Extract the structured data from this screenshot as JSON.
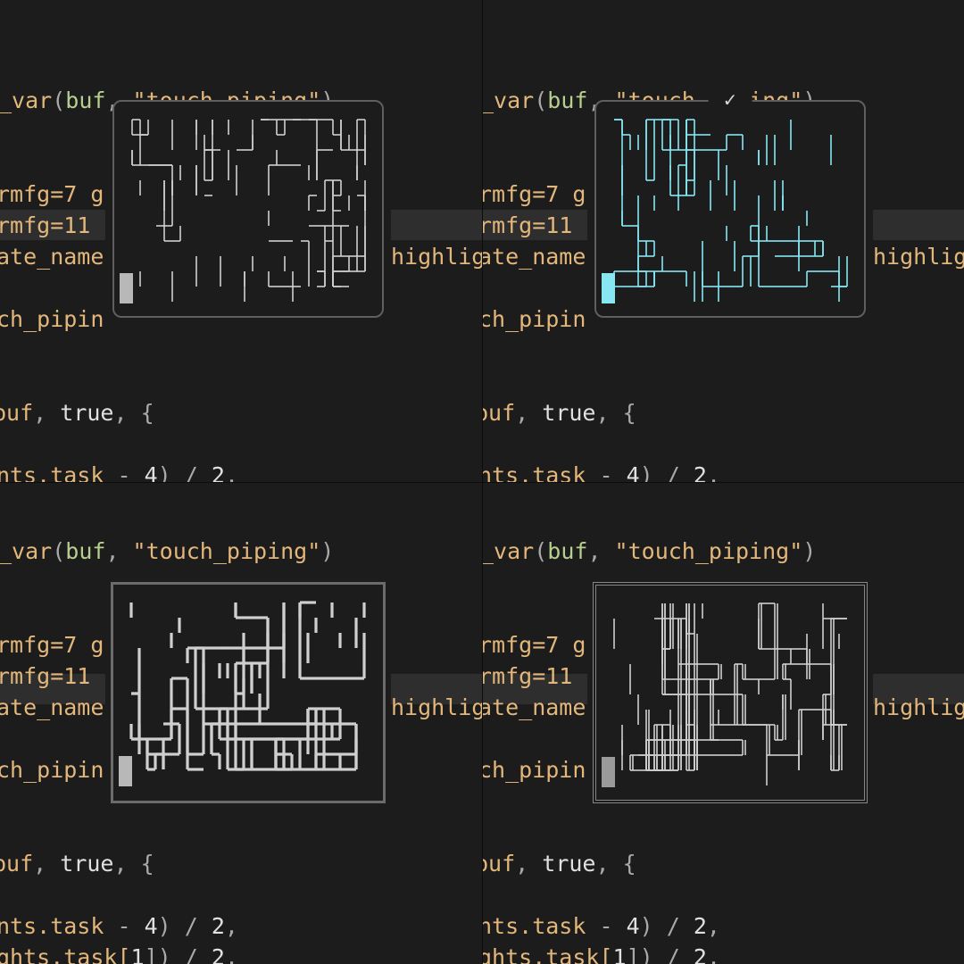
{
  "code_lines": [
    [
      {
        "t": "_var",
        "c": "c-orange"
      },
      {
        "t": "(",
        "c": "c-gray"
      },
      {
        "t": "buf",
        "c": "c-green"
      },
      {
        "t": ", ",
        "c": "c-gray"
      },
      {
        "t": "\"touch_piping\"",
        "c": "c-orange"
      },
      {
        "t": ")",
        "c": "c-gray"
      }
    ],
    [
      {
        "t": "rmfg=7 g",
        "c": "c-orange"
      }
    ],
    [
      {
        "t": "rmfg=11",
        "c": "c-orange"
      }
    ],
    [
      {
        "t": "ate_name",
        "c": "c-orange"
      }
    ],
    [
      {
        "t": "ch_pipin",
        "c": "c-orange"
      }
    ],
    [
      {
        "t": "buf",
        "c": "c-orange"
      },
      {
        "t": ", ",
        "c": "c-gray"
      },
      {
        "t": "true",
        "c": "c-white"
      },
      {
        "t": ", ",
        "c": "c-gray"
      },
      {
        "t": "{",
        "c": "c-gray"
      }
    ],
    [
      {
        "t": "nts.task",
        "c": "c-orange"
      },
      {
        "t": " - ",
        "c": "c-gray"
      },
      {
        "t": "4",
        "c": "c-white"
      },
      {
        "t": ") / ",
        "c": "c-gray"
      },
      {
        "t": "2",
        "c": "c-white"
      },
      {
        "t": ",",
        "c": "c-gray"
      }
    ],
    [
      {
        "t": "ghts.task[",
        "c": "c-orange"
      },
      {
        "t": "1",
        "c": "c-white"
      },
      {
        "t": "]) / ",
        "c": "c-gray"
      },
      {
        "t": "2",
        "c": "c-white"
      },
      {
        "t": ",",
        "c": "c-gray"
      }
    ]
  ],
  "right_fragment": "highlig",
  "panes": [
    {
      "name": "pane-rounded-gray",
      "border": "rounded",
      "pipe_color": "#cfcfcf",
      "cursor_color": "#b8b8b8",
      "line_width": 1.6,
      "check": ""
    },
    {
      "name": "pane-rounded-cyan",
      "border": "rounded",
      "pipe_color": "#86e6f2",
      "cursor_color": "#86e6f2",
      "line_width": 1.6,
      "check": "✓"
    },
    {
      "name": "pane-heavy-square",
      "border": "square",
      "pipe_color": "#cfcfcf",
      "cursor_color": "#b8b8b8",
      "line_width": 3.2,
      "check": ""
    },
    {
      "name": "pane-double-line",
      "border": "double",
      "pipe_color": "#cfcfcf",
      "cursor_color": "#9a9a9a",
      "line_width": 1.6,
      "check": ""
    }
  ]
}
